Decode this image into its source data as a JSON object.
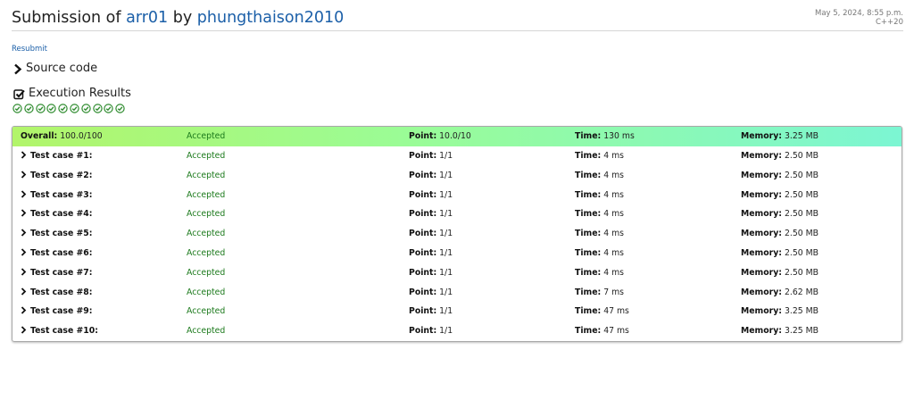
{
  "header": {
    "title_prefix": "Submission of ",
    "problem": "arr01",
    "by": " by ",
    "user": "phungthaison2010",
    "date": "May 5, 2024, 8:55 p.m.",
    "language": "C++20"
  },
  "resubmit_label": "Resubmit",
  "source_code": {
    "label": "Source code",
    "icon": "chevron-right-icon"
  },
  "execution": {
    "label": "Execution Results",
    "icon": "checkbox-checked-icon",
    "check_count": 10
  },
  "overall": {
    "label": "Overall:",
    "score": "100.0/100",
    "status": "Accepted",
    "point_label": "Point:",
    "point": "10.0/10",
    "time_label": "Time:",
    "time": "130 ms",
    "memory_label": "Memory:",
    "memory": "3.25 MB"
  },
  "labels": {
    "point": "Point:",
    "time": "Time:",
    "memory": "Memory:"
  },
  "test_cases": [
    {
      "name": "Test case #1:",
      "status": "Accepted",
      "point": "1/1",
      "time": "4 ms",
      "memory": "2.50 MB"
    },
    {
      "name": "Test case #2:",
      "status": "Accepted",
      "point": "1/1",
      "time": "4 ms",
      "memory": "2.50 MB"
    },
    {
      "name": "Test case #3:",
      "status": "Accepted",
      "point": "1/1",
      "time": "4 ms",
      "memory": "2.50 MB"
    },
    {
      "name": "Test case #4:",
      "status": "Accepted",
      "point": "1/1",
      "time": "4 ms",
      "memory": "2.50 MB"
    },
    {
      "name": "Test case #5:",
      "status": "Accepted",
      "point": "1/1",
      "time": "4 ms",
      "memory": "2.50 MB"
    },
    {
      "name": "Test case #6:",
      "status": "Accepted",
      "point": "1/1",
      "time": "4 ms",
      "memory": "2.50 MB"
    },
    {
      "name": "Test case #7:",
      "status": "Accepted",
      "point": "1/1",
      "time": "4 ms",
      "memory": "2.50 MB"
    },
    {
      "name": "Test case #8:",
      "status": "Accepted",
      "point": "1/1",
      "time": "7 ms",
      "memory": "2.62 MB"
    },
    {
      "name": "Test case #9:",
      "status": "Accepted",
      "point": "1/1",
      "time": "47 ms",
      "memory": "3.25 MB"
    },
    {
      "name": "Test case #10:",
      "status": "Accepted",
      "point": "1/1",
      "time": "47 ms",
      "memory": "3.25 MB"
    }
  ],
  "colors": {
    "link": "#1b5fa8",
    "accepted": "#1c7a1c",
    "check": "#2e8b2e"
  }
}
